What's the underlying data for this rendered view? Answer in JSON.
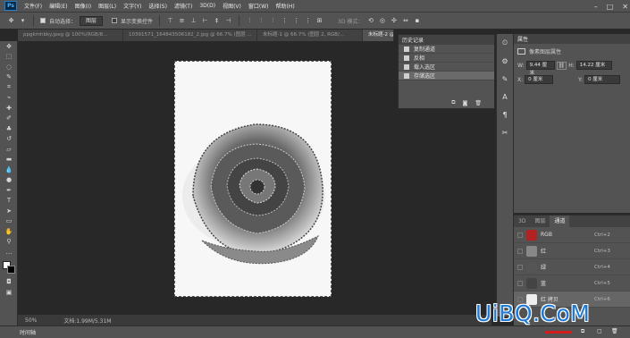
{
  "menubar": {
    "logo": "Ps",
    "items": [
      "文件(F)",
      "编辑(E)",
      "图像(I)",
      "图层(L)",
      "文字(Y)",
      "选择(S)",
      "滤镜(T)",
      "3D(D)",
      "视图(V)",
      "窗口(W)",
      "帮助(H)"
    ],
    "window_controls": [
      "–",
      "□",
      "✕"
    ]
  },
  "options": {
    "auto_select_label": "自动选择：",
    "auto_select_value": "图层",
    "show_transform_label": "显示变换控件",
    "mode_3d_label": "3D 模式："
  },
  "tabs": [
    "ppgkmhbky.jpeg @ 100%(RGB/8...",
    "10391571_164843506182_2.jpg @ 66.7% (图层 ...",
    "未标题-1 @ 66.7% (图层 2, RGB/...",
    "未标题-2 @..."
  ],
  "history": {
    "title": "历史记录",
    "items": [
      "复制通道",
      "反相",
      "载入选区",
      "存储选区"
    ],
    "selected_index": 3
  },
  "properties": {
    "title": "属性",
    "subtitle": "像素图层属性",
    "w_label": "W:",
    "w_value": "9.44 厘米",
    "h_label": "H:",
    "h_value": "14.22 厘米",
    "x_label": "X:",
    "x_value": "0 厘米",
    "y_label": "Y:",
    "y_value": "0 厘米"
  },
  "channels": {
    "tabs": [
      "3D",
      "图层",
      "通道"
    ],
    "active_tab": "通道",
    "rows": [
      {
        "name": "RGB",
        "key": "Ctrl+2",
        "color": "#b22222"
      },
      {
        "name": "红",
        "key": "Ctrl+3",
        "color": "#888888"
      },
      {
        "name": "绿",
        "key": "Ctrl+4",
        "color": "#555555"
      },
      {
        "name": "蓝",
        "key": "Ctrl+5",
        "color": "#444444"
      },
      {
        "name": "红 拷贝",
        "key": "Ctrl+6",
        "color": "#eeeeee"
      }
    ]
  },
  "status": {
    "zoom": "50%",
    "doc": "文档:1.99M/5.31M"
  },
  "timeline": {
    "label": "时间轴"
  },
  "watermark": "UiBQ.CoM",
  "toolbox_icons": [
    "move-icon",
    "marquee-icon",
    "lasso-icon",
    "quick-select-icon",
    "crop-icon",
    "eyedropper-icon",
    "healing-icon",
    "brush-icon",
    "stamp-icon",
    "history-brush-icon",
    "eraser-icon",
    "gradient-icon",
    "blur-icon",
    "dodge-icon",
    "pen-icon",
    "type-icon",
    "path-select-icon",
    "shape-icon",
    "hand-icon",
    "zoom-icon",
    "more-icon"
  ]
}
